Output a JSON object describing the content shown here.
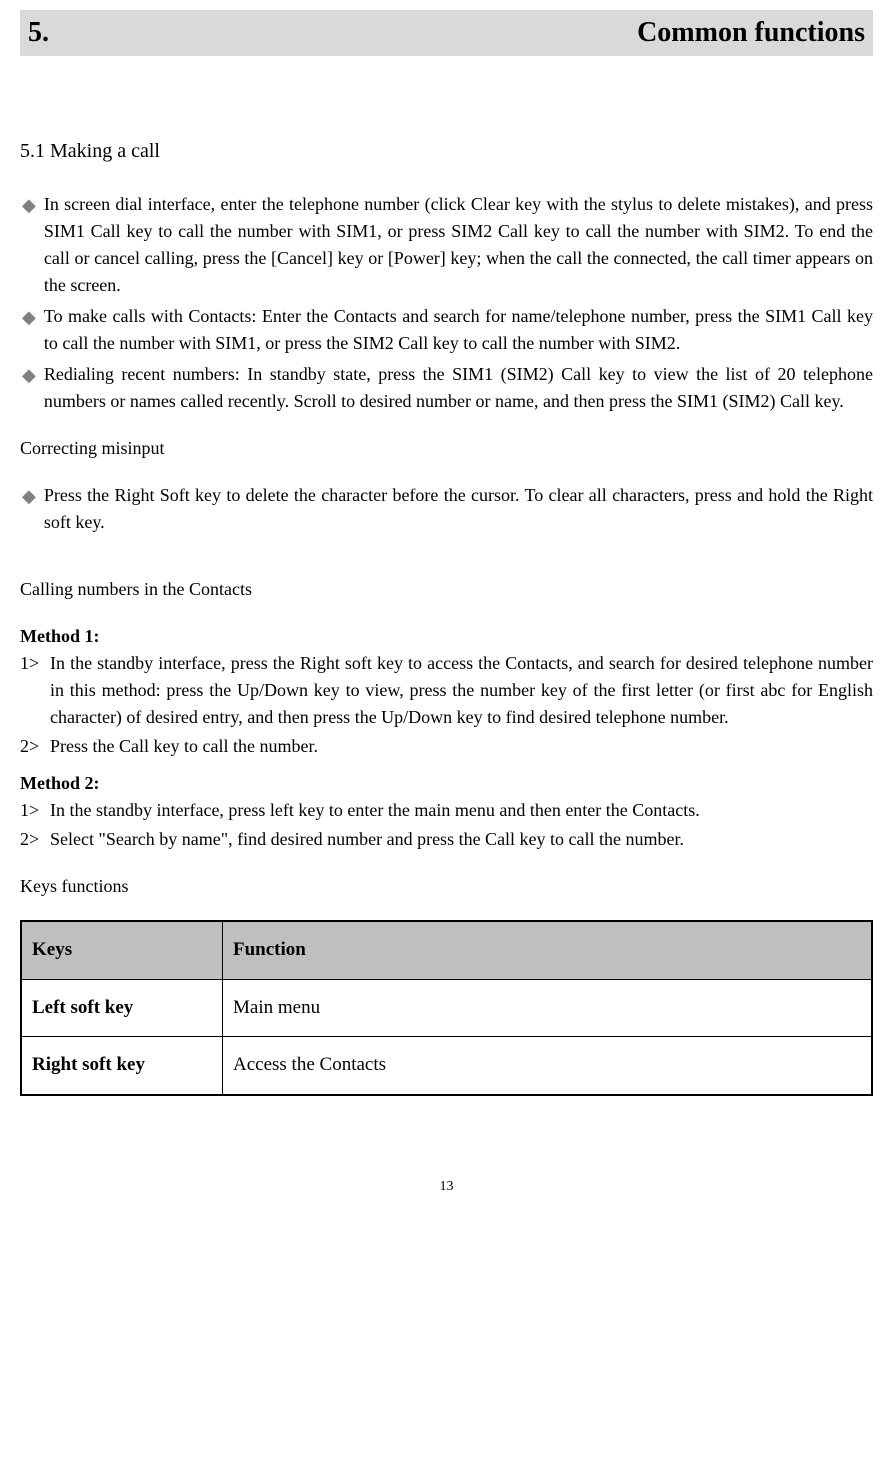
{
  "header": {
    "number": "5.",
    "title": "Common functions"
  },
  "section1": {
    "heading": "5.1 Making a call",
    "bullets": [
      "In screen dial interface, enter the telephone number (click Clear key with the stylus to delete mistakes), and press SIM1 Call key to call the number with SIM1, or press SIM2 Call key to call the number with SIM2. To end the call or cancel calling, press the [Cancel] key or [Power] key; when the call the connected, the call timer appears on the screen.",
      "To make calls with Contacts: Enter the Contacts and search for name/telephone number, press the SIM1 Call key to call the number with SIM1, or press the SIM2 Call key to call the number with SIM2.",
      "Redialing recent numbers: In standby state, press the SIM1 (SIM2) Call key to view the list of 20 telephone numbers or names called recently. Scroll to desired number or name, and then press the SIM1 (SIM2) Call key."
    ]
  },
  "correcting": {
    "heading": "Correcting misinput",
    "bullet": "Press the Right Soft key to delete the character before the cursor. To clear all characters, press and hold the Right soft key."
  },
  "calling_contacts": {
    "heading": "Calling numbers in the Contacts",
    "method1_label": "Method 1:",
    "method1_steps": [
      "In the standby interface, press the Right soft key to access the Contacts, and search for desired telephone number in this method: press the Up/Down key to view, press the number key of the first letter (or first abc for English character) of desired entry, and then press the Up/Down key to find desired telephone number.",
      "Press the Call key to call the number."
    ],
    "method2_label": "Method 2:",
    "method2_steps": [
      "In the standby interface, press left key to enter the main menu and then enter the Contacts.",
      "Select \"Search by name\", find desired number and press the Call key to call the number."
    ]
  },
  "keys_section": {
    "heading": "Keys functions",
    "header_keys": "Keys",
    "header_function": "Function",
    "rows": [
      {
        "key": "Left soft key",
        "function": "Main menu"
      },
      {
        "key": "Right soft key",
        "function": "Access the Contacts"
      }
    ]
  },
  "step_labels": {
    "s1": "1>",
    "s2": "2>"
  },
  "page_number": "13"
}
